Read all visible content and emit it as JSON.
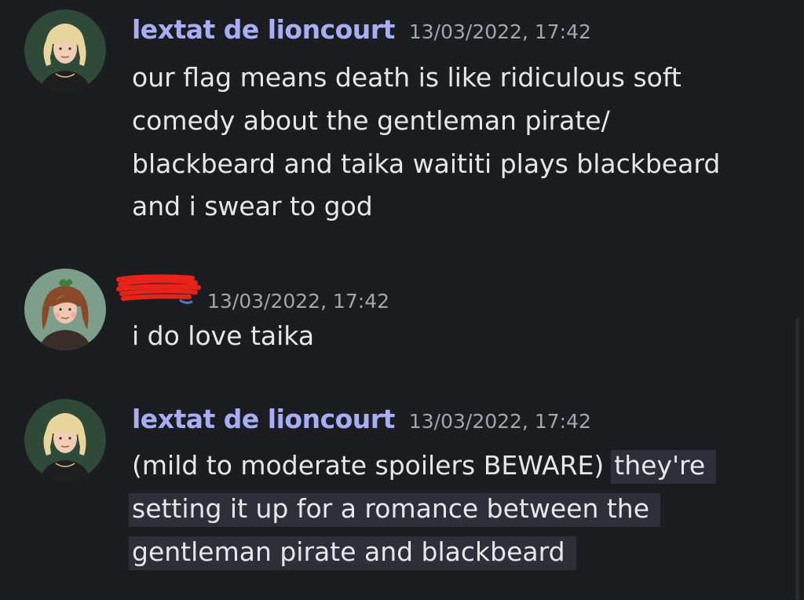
{
  "messages": [
    {
      "author": "lextat de lioncourt",
      "timestamp": "13/03/2022, 17:42",
      "lines": [
        "our flag means death is like ridiculous soft",
        "comedy about the gentleman pirate/",
        "blackbeard and taika waititi plays blackbeard",
        "and i swear to god"
      ]
    },
    {
      "author": "",
      "timestamp": "13/03/2022, 17:42",
      "lines": [
        "i do love taika"
      ]
    },
    {
      "author": "lextat de lioncourt",
      "timestamp": "13/03/2022, 17:42",
      "lines": [
        "(mild to moderate spoilers BEWARE)",
        "they're",
        "setting it up for a romance between the",
        "gentleman pirate and blackbeard"
      ]
    }
  ],
  "colors": {
    "background": "#1c1d21",
    "username": "#a8aef5",
    "timestamp": "#a3a6ad",
    "text": "#e6e7ea",
    "highlight": "#2e3039",
    "redaction": "#e8231a"
  },
  "icons": {
    "avatar_1": "blonde-character-avatar",
    "avatar_2": "red-haired-character-avatar",
    "avatar_3": "blonde-character-avatar",
    "redaction": "red-scribble-redaction"
  }
}
